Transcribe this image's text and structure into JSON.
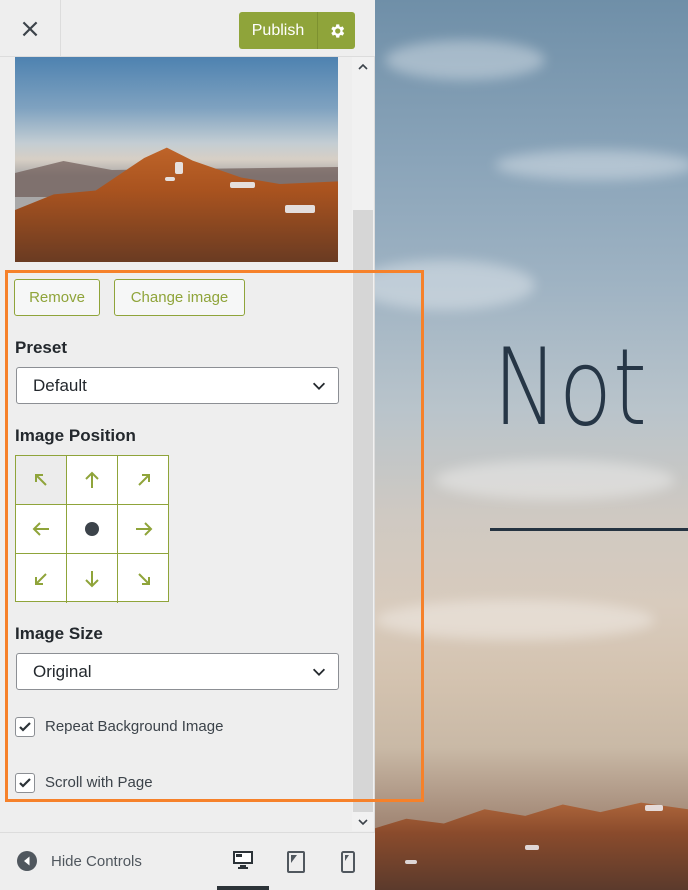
{
  "header": {
    "close_label": "×",
    "publish_label": "Publish",
    "gear_icon": "gear-icon"
  },
  "media": {
    "remove_label": "Remove",
    "change_label": "Change image"
  },
  "preset": {
    "label": "Preset",
    "value": "Default"
  },
  "position": {
    "label": "Image Position",
    "selected": "top-left",
    "cells": [
      "top-left",
      "top",
      "top-right",
      "left",
      "center",
      "right",
      "bottom-left",
      "bottom",
      "bottom-right"
    ]
  },
  "size": {
    "label": "Image Size",
    "value": "Original"
  },
  "options": {
    "repeat_label": "Repeat Background Image",
    "repeat_checked": true,
    "scroll_label": "Scroll with Page",
    "scroll_checked": true
  },
  "footer": {
    "hide_label": "Hide Controls",
    "devices": [
      "desktop",
      "tablet",
      "mobile"
    ],
    "active_device": "desktop"
  },
  "preview": {
    "site_title": "Not"
  },
  "colors": {
    "accent": "#8fa43a",
    "highlight": "#f6812a",
    "title": "#263646"
  }
}
